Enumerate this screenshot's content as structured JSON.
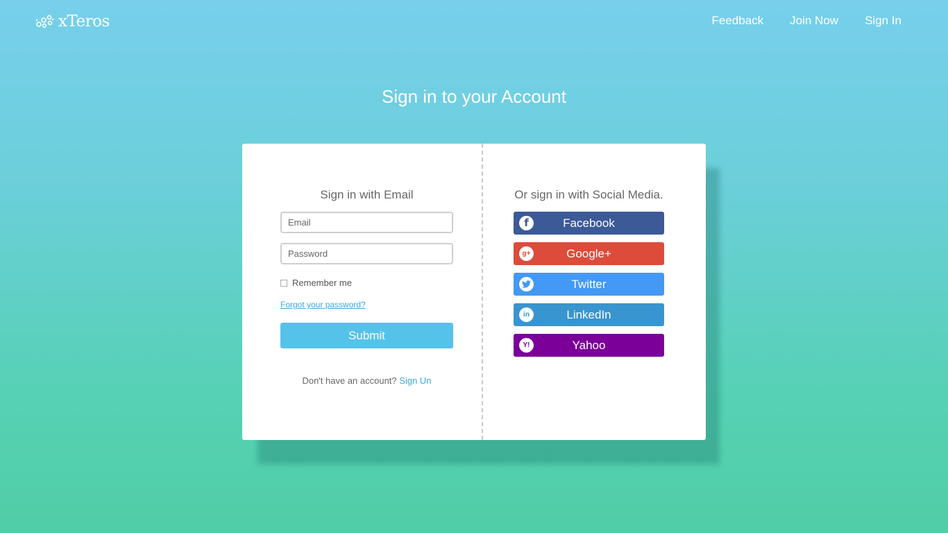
{
  "header": {
    "logo_text": "xTeros",
    "nav": {
      "feedback": "Feedback",
      "join_now": "Join Now",
      "sign_in": "Sign In"
    }
  },
  "page": {
    "title": "Sign in to your Account"
  },
  "email_signin": {
    "heading": "Sign in with Email",
    "email_placeholder": "Email",
    "password_placeholder": "Password",
    "remember_label": "Remember me",
    "remember_checked": false,
    "forgot_link": "Forgot your password?",
    "submit_label": "Submit",
    "no_account_text": "Don't have an account?",
    "signup_link": "Sign Un"
  },
  "social_signin": {
    "heading": "Or sign in with Social Media.",
    "buttons": [
      {
        "label": "Facebook",
        "icon": "facebook-icon",
        "color": "#3c5998"
      },
      {
        "label": "Google+",
        "icon": "google-plus-icon",
        "color": "#dd4b3a"
      },
      {
        "label": "Twitter",
        "icon": "twitter-icon",
        "color": "#4399f3"
      },
      {
        "label": "LinkedIn",
        "icon": "linkedin-icon",
        "color": "#3895cf"
      },
      {
        "label": "Yahoo",
        "icon": "yahoo-icon",
        "color": "#7b0099"
      }
    ]
  },
  "colors": {
    "background_top": "#77cfec",
    "background_bottom": "#50cea6",
    "submit": "#55c2ea",
    "link": "#3aa8d8"
  }
}
